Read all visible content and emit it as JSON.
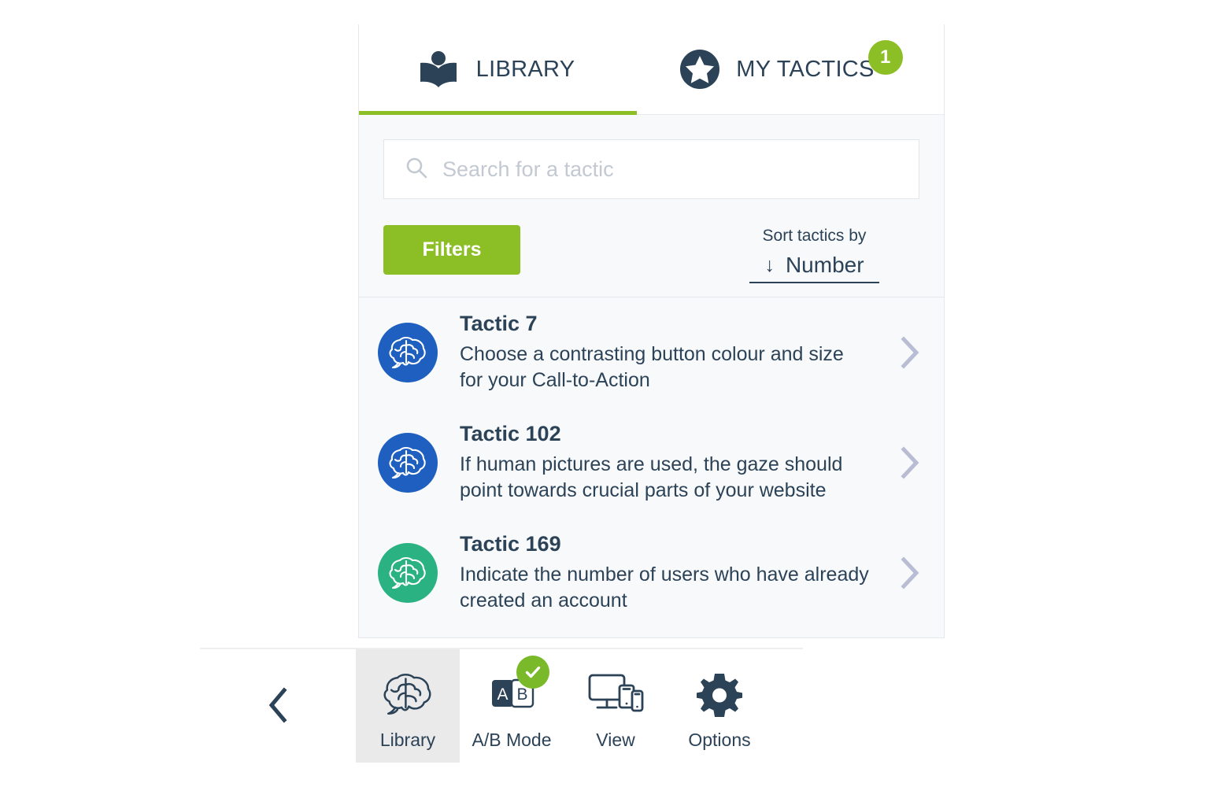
{
  "tabs": [
    {
      "id": "library",
      "label": "LIBRARY",
      "icon": "book-reader-icon",
      "active": true,
      "badge": null
    },
    {
      "id": "my-tactics",
      "label": "MY TACTICS",
      "icon": "star-circle-icon",
      "active": false,
      "badge": "1"
    }
  ],
  "search": {
    "placeholder": "Search for a tactic",
    "value": "",
    "icon": "search-icon"
  },
  "filters": {
    "label": "Filters"
  },
  "sort": {
    "caption": "Sort tactics by",
    "direction_arrow": "↓",
    "value": "Number"
  },
  "tactics": [
    {
      "title": "Tactic 7",
      "description": "Choose a contrasting button colour and size for your Call-to-Action",
      "icon": "brain-icon",
      "icon_color": "#1f5fc0",
      "chevron": "chevron-right-icon"
    },
    {
      "title": "Tactic 102",
      "description": "If human pictures are used, the gaze should point towards crucial parts of your website",
      "icon": "brain-icon",
      "icon_color": "#1f5fc0",
      "chevron": "chevron-right-icon"
    },
    {
      "title": "Tactic 169",
      "description": "Indicate the number of users who have already created an account",
      "icon": "brain-icon",
      "icon_color": "#2bb283",
      "chevron": "chevron-right-icon"
    }
  ],
  "toolbar": {
    "back_icon": "chevron-left-icon",
    "items": [
      {
        "id": "library",
        "label": "Library",
        "icon": "brain-icon",
        "active": true,
        "check_badge": false
      },
      {
        "id": "ab-mode",
        "label": "A/B Mode",
        "icon": "ab-test-icon",
        "active": false,
        "check_badge": true,
        "letter_a": "A",
        "letter_b": "B"
      },
      {
        "id": "view",
        "label": "View",
        "icon": "devices-icon",
        "active": false,
        "check_badge": false
      },
      {
        "id": "options",
        "label": "Options",
        "icon": "gear-icon",
        "active": false,
        "check_badge": false
      }
    ]
  },
  "colors": {
    "green": "#8cbe26",
    "navy": "#2b4257",
    "blue": "#1f5fc0",
    "teal": "#2bb283",
    "chevron_gray": "#b9bdd4",
    "panel_bg": "#f8f9fb"
  }
}
